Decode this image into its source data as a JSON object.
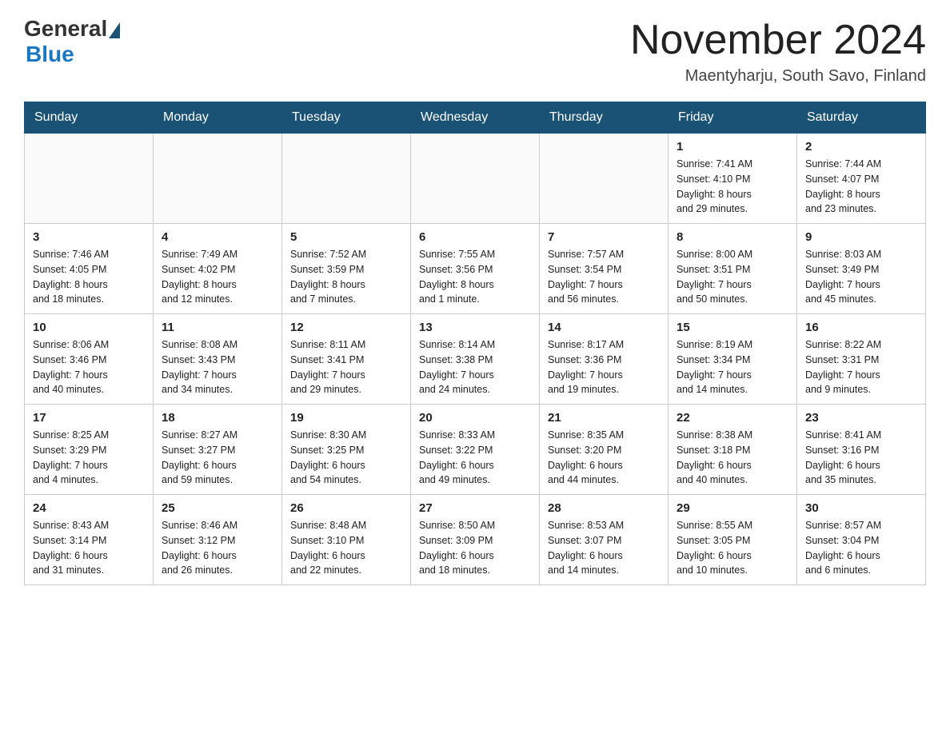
{
  "header": {
    "logo_general": "General",
    "logo_blue": "Blue",
    "title": "November 2024",
    "location": "Maentyharju, South Savo, Finland"
  },
  "days_of_week": [
    "Sunday",
    "Monday",
    "Tuesday",
    "Wednesday",
    "Thursday",
    "Friday",
    "Saturday"
  ],
  "weeks": [
    [
      {
        "day": "",
        "info": ""
      },
      {
        "day": "",
        "info": ""
      },
      {
        "day": "",
        "info": ""
      },
      {
        "day": "",
        "info": ""
      },
      {
        "day": "",
        "info": ""
      },
      {
        "day": "1",
        "info": "Sunrise: 7:41 AM\nSunset: 4:10 PM\nDaylight: 8 hours\nand 29 minutes."
      },
      {
        "day": "2",
        "info": "Sunrise: 7:44 AM\nSunset: 4:07 PM\nDaylight: 8 hours\nand 23 minutes."
      }
    ],
    [
      {
        "day": "3",
        "info": "Sunrise: 7:46 AM\nSunset: 4:05 PM\nDaylight: 8 hours\nand 18 minutes."
      },
      {
        "day": "4",
        "info": "Sunrise: 7:49 AM\nSunset: 4:02 PM\nDaylight: 8 hours\nand 12 minutes."
      },
      {
        "day": "5",
        "info": "Sunrise: 7:52 AM\nSunset: 3:59 PM\nDaylight: 8 hours\nand 7 minutes."
      },
      {
        "day": "6",
        "info": "Sunrise: 7:55 AM\nSunset: 3:56 PM\nDaylight: 8 hours\nand 1 minute."
      },
      {
        "day": "7",
        "info": "Sunrise: 7:57 AM\nSunset: 3:54 PM\nDaylight: 7 hours\nand 56 minutes."
      },
      {
        "day": "8",
        "info": "Sunrise: 8:00 AM\nSunset: 3:51 PM\nDaylight: 7 hours\nand 50 minutes."
      },
      {
        "day": "9",
        "info": "Sunrise: 8:03 AM\nSunset: 3:49 PM\nDaylight: 7 hours\nand 45 minutes."
      }
    ],
    [
      {
        "day": "10",
        "info": "Sunrise: 8:06 AM\nSunset: 3:46 PM\nDaylight: 7 hours\nand 40 minutes."
      },
      {
        "day": "11",
        "info": "Sunrise: 8:08 AM\nSunset: 3:43 PM\nDaylight: 7 hours\nand 34 minutes."
      },
      {
        "day": "12",
        "info": "Sunrise: 8:11 AM\nSunset: 3:41 PM\nDaylight: 7 hours\nand 29 minutes."
      },
      {
        "day": "13",
        "info": "Sunrise: 8:14 AM\nSunset: 3:38 PM\nDaylight: 7 hours\nand 24 minutes."
      },
      {
        "day": "14",
        "info": "Sunrise: 8:17 AM\nSunset: 3:36 PM\nDaylight: 7 hours\nand 19 minutes."
      },
      {
        "day": "15",
        "info": "Sunrise: 8:19 AM\nSunset: 3:34 PM\nDaylight: 7 hours\nand 14 minutes."
      },
      {
        "day": "16",
        "info": "Sunrise: 8:22 AM\nSunset: 3:31 PM\nDaylight: 7 hours\nand 9 minutes."
      }
    ],
    [
      {
        "day": "17",
        "info": "Sunrise: 8:25 AM\nSunset: 3:29 PM\nDaylight: 7 hours\nand 4 minutes."
      },
      {
        "day": "18",
        "info": "Sunrise: 8:27 AM\nSunset: 3:27 PM\nDaylight: 6 hours\nand 59 minutes."
      },
      {
        "day": "19",
        "info": "Sunrise: 8:30 AM\nSunset: 3:25 PM\nDaylight: 6 hours\nand 54 minutes."
      },
      {
        "day": "20",
        "info": "Sunrise: 8:33 AM\nSunset: 3:22 PM\nDaylight: 6 hours\nand 49 minutes."
      },
      {
        "day": "21",
        "info": "Sunrise: 8:35 AM\nSunset: 3:20 PM\nDaylight: 6 hours\nand 44 minutes."
      },
      {
        "day": "22",
        "info": "Sunrise: 8:38 AM\nSunset: 3:18 PM\nDaylight: 6 hours\nand 40 minutes."
      },
      {
        "day": "23",
        "info": "Sunrise: 8:41 AM\nSunset: 3:16 PM\nDaylight: 6 hours\nand 35 minutes."
      }
    ],
    [
      {
        "day": "24",
        "info": "Sunrise: 8:43 AM\nSunset: 3:14 PM\nDaylight: 6 hours\nand 31 minutes."
      },
      {
        "day": "25",
        "info": "Sunrise: 8:46 AM\nSunset: 3:12 PM\nDaylight: 6 hours\nand 26 minutes."
      },
      {
        "day": "26",
        "info": "Sunrise: 8:48 AM\nSunset: 3:10 PM\nDaylight: 6 hours\nand 22 minutes."
      },
      {
        "day": "27",
        "info": "Sunrise: 8:50 AM\nSunset: 3:09 PM\nDaylight: 6 hours\nand 18 minutes."
      },
      {
        "day": "28",
        "info": "Sunrise: 8:53 AM\nSunset: 3:07 PM\nDaylight: 6 hours\nand 14 minutes."
      },
      {
        "day": "29",
        "info": "Sunrise: 8:55 AM\nSunset: 3:05 PM\nDaylight: 6 hours\nand 10 minutes."
      },
      {
        "day": "30",
        "info": "Sunrise: 8:57 AM\nSunset: 3:04 PM\nDaylight: 6 hours\nand 6 minutes."
      }
    ]
  ]
}
